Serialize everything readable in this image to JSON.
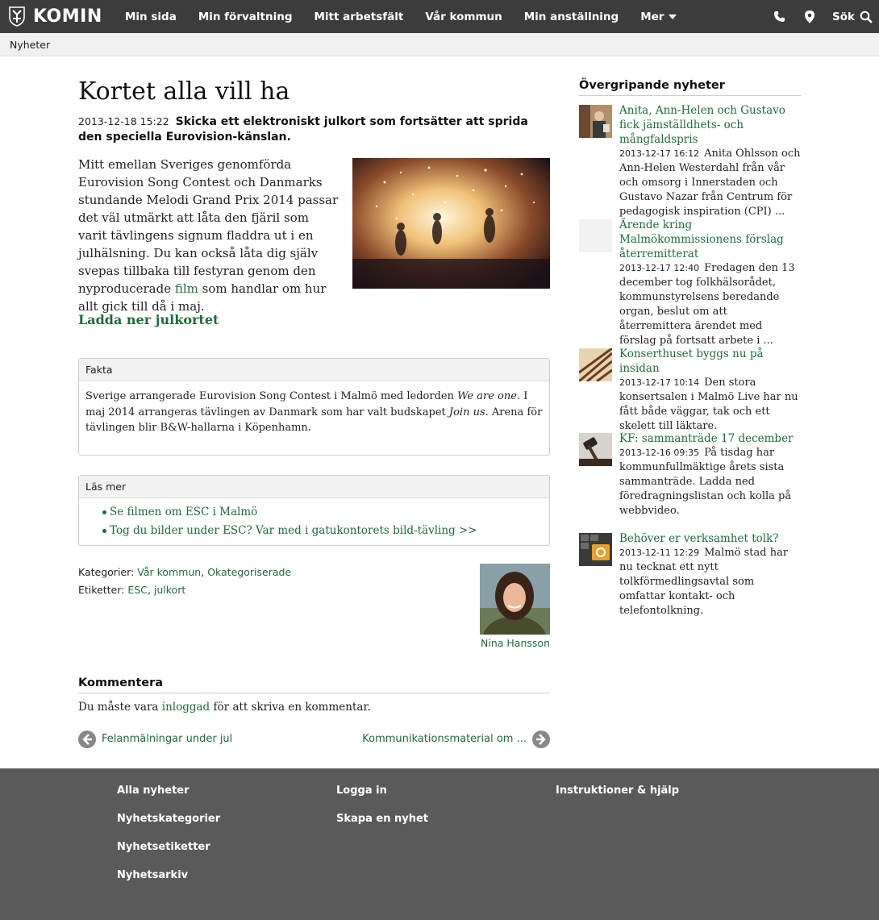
{
  "colors": {
    "topbar": "#3c3c3c",
    "link": "#1f6b3a",
    "footer": "#5a5a5a"
  },
  "header": {
    "logo_text": "KOMIN",
    "nav": [
      "Min sida",
      "Min förvaltning",
      "Mitt arbetsfält",
      "Vår kommun",
      "Min anställning",
      "Mer"
    ],
    "search_label": "Sök",
    "icons": [
      "phone-icon",
      "location-pin-icon",
      "search-icon"
    ]
  },
  "breadcrumb": "Nyheter",
  "article": {
    "title": "Kortet alla vill ha",
    "date": "2013-12-18 15:22",
    "ingress": "Skicka ett elektroniskt julkort som fortsätter att sprida den speciella Eurovision-känslan.",
    "body_before_link": "Mitt emellan Sveriges genomförda Eurovision Song Contest och Danmarks stundande Melodi Grand Prix 2014 passar det väl utmärkt att låta den fjäril som varit tävlingens signum fladdra ut i en julhälsning. Du kan också låta dig själv svepas tillbaka till festyran genom den nyproducerade ",
    "body_link": "film",
    "body_after_link": " som handlar om hur allt gick till då i maj.",
    "download_link": "Ladda ner julkortet"
  },
  "fakta": {
    "heading": "Fakta",
    "text_1": "Sverige arrangerade Eurovision Song Contest i Malmö med ledorden ",
    "em_1": "We are one",
    "text_2": ". I maj 2014 arrangeras tävlingen av Danmark som har valt budskapet ",
    "em_2": "Join us",
    "text_3": ". Arena för tävlingen blir B&W-hallarna i Köpenhamn."
  },
  "read_more": {
    "heading": "Läs mer",
    "links": [
      "Se filmen om ESC i Malmö",
      "Tog du bilder under ESC? Var med i gatukontorets bild-tävling >>"
    ]
  },
  "meta": {
    "categories_label": "Kategorier:",
    "categories": [
      "Vår kommun",
      "Okategoriserade"
    ],
    "tags_label": "Etiketter:",
    "tags": [
      "ESC",
      "julkort"
    ],
    "author": "Nina Hansson"
  },
  "comment": {
    "heading": "Kommentera",
    "text_before": "Du måste vara ",
    "link": "inloggad",
    "text_after": " för att skriva en kommentar."
  },
  "pager": {
    "prev": "Felanmälningar under jul",
    "next": "Kommunikationsmaterial om ..."
  },
  "sidebar": {
    "heading": "Övergripande nyheter",
    "items": [
      {
        "title": "Anita, Ann-Helen och Gustavo fick jämställdhets- och mångfaldspris",
        "date": "2013-12-17 16:12",
        "excerpt": "Anita Ohlsson och Ann-Helen Westerdahl från vår och omsorg i Innerstaden och Gustavo Nazar från Centrum för pedagogisk inspiration (CPI) ..."
      },
      {
        "title": "Ärende kring Malmökommissionens förslag återremitterat",
        "date": "2013-12-17 12:40",
        "excerpt": "Fredagen den 13 december tog folkhälsorådet, kommunstyrelsens beredande organ, beslut om att återremittera ärendet med förslag på fortsatt arbete i ..."
      },
      {
        "title": "Konserthuset byggs nu på insidan",
        "date": "2013-12-17 10:14",
        "excerpt": "Den stora konsertsalen i Malmö Live har nu fått både väggar, tak och ett skelett till läktare."
      },
      {
        "title": "KF: sammanträde 17 december",
        "date": "2013-12-16 09:35",
        "excerpt": "På tisdag har kommunfullmäktige årets sista sammanträde. Ladda ned föredragningslistan och kolla på webbvideo."
      },
      {
        "title": "Behöver er verksamhet tolk?",
        "date": "2013-12-11 12:29",
        "excerpt": "Malmö stad har nu tecknat ett nytt tolkförmedlingsavtal som omfattar kontakt- och telefontolkning."
      }
    ]
  },
  "footer": {
    "col1": [
      "Alla nyheter",
      "Nyhetskategorier",
      "Nyhetsetiketter",
      "Nyhetsarkiv"
    ],
    "col2": [
      "Logga in",
      "Skapa en nyhet"
    ],
    "col3": [
      "Instruktioner & hjälp"
    ]
  }
}
